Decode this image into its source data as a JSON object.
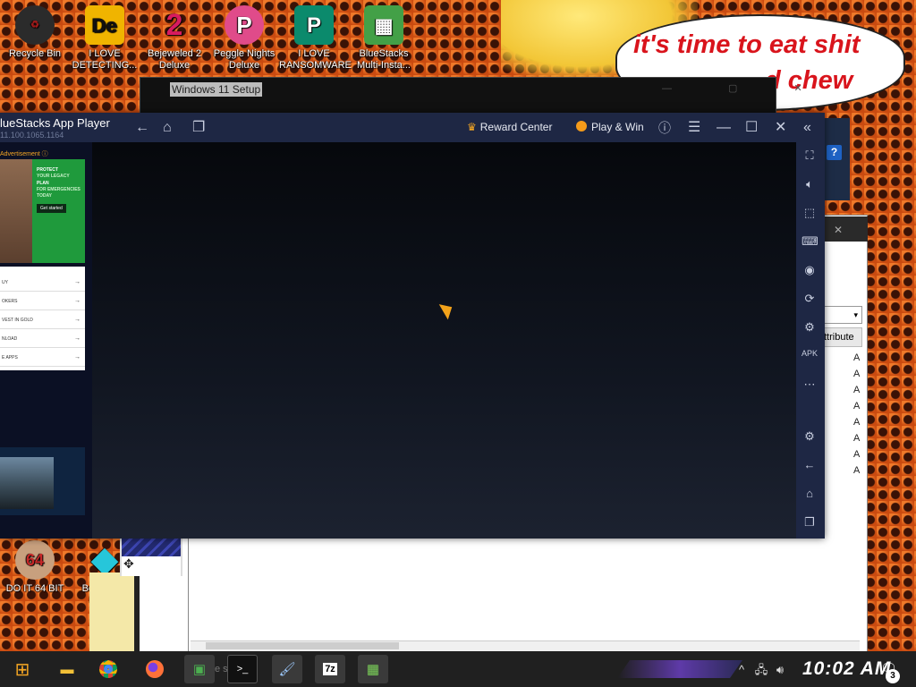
{
  "speech_bubble": {
    "line1": "it's time to eat shit",
    "line2": "d      chew",
    "line2_tail": "d"
  },
  "desktop_icons": [
    {
      "label": "Recycle Bin",
      "icon": "recycle-bin-icon",
      "glyph": "♻",
      "color": "#2e7d32"
    },
    {
      "label": "I LOVE DETECTING...",
      "icon": "de-app-icon",
      "glyph": "De",
      "color": "#e6a300"
    },
    {
      "label": "Bejeweled 2 Deluxe",
      "icon": "bejeweled-2-icon",
      "glyph": "2",
      "color": "#c2185b"
    },
    {
      "label": "Peggle Nights Deluxe",
      "icon": "peggle-nights-icon",
      "glyph": "P",
      "color": "#1976d2"
    },
    {
      "label": "I LOVE RANSOMWARE",
      "icon": "publisher-icon",
      "glyph": "P",
      "color": "#0b8a6c"
    },
    {
      "label": "BlueStacks Multi-Insta...",
      "icon": "bluestacks-multi-icon",
      "glyph": "▦",
      "color": "#43a047"
    },
    {
      "label": "DO IT 64 BIT",
      "icon": "do-it-64-bit-icon",
      "glyph": "64",
      "color": "#8d3b2a"
    },
    {
      "label": "Bejeweled Deluxe",
      "icon": "bejeweled-deluxe-icon",
      "glyph": "◆",
      "color": "#26c6da"
    }
  ],
  "windows": {
    "setup_title": "Windows 11 Setup",
    "bg_help": "?",
    "bg_close": "✕",
    "bg_dropdown": "▾",
    "bg_attr_header": "ttribute",
    "bg_attr_cells": [
      "A",
      "A",
      "A",
      "A",
      "A",
      "A",
      "A",
      "A"
    ]
  },
  "bluestacks": {
    "title": "lueStacks App Player",
    "version": "11.100.1065.1164",
    "reward_label": "Reward Center",
    "play_label": "Play & Win",
    "titlebar_icons": [
      "back-arrow-icon",
      "home-icon",
      "recent-apps-icon",
      "help-icon",
      "menu-icon",
      "minimize-icon",
      "maximize-icon",
      "close-icon",
      "collapse-sidebar-icon"
    ],
    "sidebar_icons": [
      "fullscreen-icon",
      "volume-icon",
      "cursor-icon",
      "keyboard-icon",
      "record-icon",
      "rotate-icon",
      "macro-icon",
      "apk-install-icon",
      "more-icon",
      "settings-icon",
      "back-icon",
      "home-icon",
      "recents-icon"
    ]
  },
  "ad": {
    "label": "Advertisement ⓘ",
    "headline1": "PROTECT",
    "headline2": "YOUR LEGACY",
    "headline3": "PLAN",
    "headline4": "FOR EMERGENCIES",
    "headline5": "TODAY",
    "cta": "Get started",
    "list": [
      "UY",
      "OKERS",
      "VEST IN GOLD",
      "NLOAD",
      "E APPS"
    ]
  },
  "taskbar": {
    "search_text": "e s sea ...",
    "clock": "10:02 AM",
    "notification_count": "3",
    "apps": [
      "start-icon",
      "file-explorer-icon",
      "chrome-icon",
      "firefox-icon",
      "setup-icon",
      "terminal-icon",
      "paint-icon",
      "7zip-icon",
      "bluestacks-icon"
    ]
  }
}
